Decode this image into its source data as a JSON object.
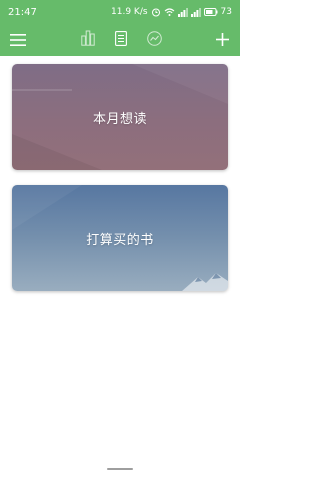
{
  "status_bar": {
    "time": "21:47",
    "net_speed": "11.9 K/s",
    "battery": "73",
    "icons": [
      "alarm-icon",
      "wifi-icon",
      "signal-icon",
      "signal-icon",
      "battery-icon"
    ]
  },
  "toolbar": {
    "icons": [
      "menu-icon",
      "bar-chart-icon",
      "list-icon",
      "trend-icon",
      "add-icon"
    ]
  },
  "cards": [
    {
      "title": "本月想读"
    },
    {
      "title": "打算买的书"
    }
  ],
  "colors": {
    "accent": "#66bb6a",
    "card1": "#8c6e7e",
    "card2": "#6c89aa"
  }
}
